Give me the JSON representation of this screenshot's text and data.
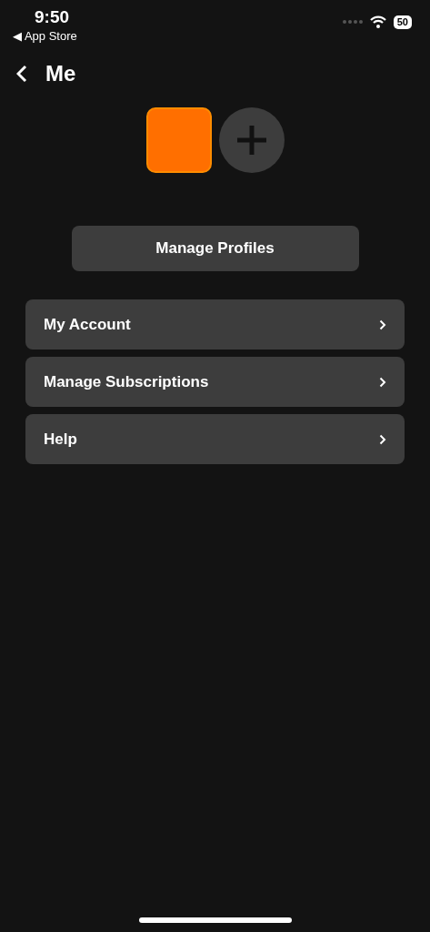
{
  "status_bar": {
    "time": "9:50",
    "back_app": "◀ App Store",
    "battery": "50"
  },
  "header": {
    "title": "Me"
  },
  "profiles": [
    {
      "color": "#ff6f00"
    }
  ],
  "manage_button": "Manage Profiles",
  "menu": [
    {
      "label": "My Account"
    },
    {
      "label": "Manage Subscriptions"
    },
    {
      "label": "Help"
    }
  ]
}
